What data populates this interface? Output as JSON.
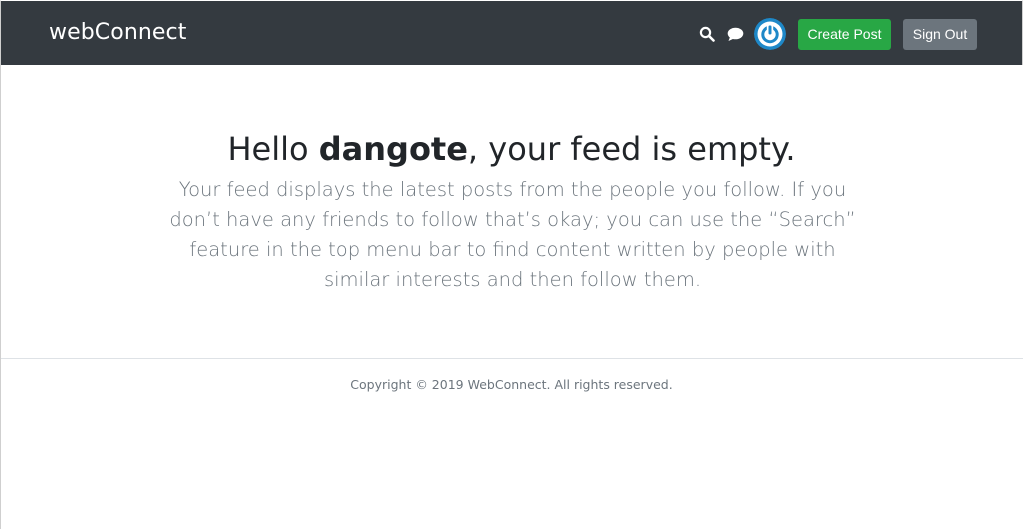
{
  "navbar": {
    "brand": "webConnect",
    "icons": {
      "search": "search-icon",
      "chat": "chat-icon",
      "avatar": "power-avatar-icon"
    },
    "create_post_label": "Create Post",
    "sign_out_label": "Sign Out",
    "colors": {
      "background": "#343a40",
      "create_post": "#28a745",
      "sign_out": "#6c757d",
      "avatar": "#1e88c8"
    }
  },
  "feed": {
    "greeting_prefix": "Hello ",
    "username": "dangote",
    "greeting_suffix": ", your feed is empty.",
    "description": "Your feed displays the latest posts from the people you follow. If you don’t have any friends to follow that’s okay; you can use the “Search” feature in the top menu bar to find content written by people with similar interests and then follow them."
  },
  "footer": {
    "copyright": "Copyright © 2019 WebConnect. All rights reserved."
  }
}
